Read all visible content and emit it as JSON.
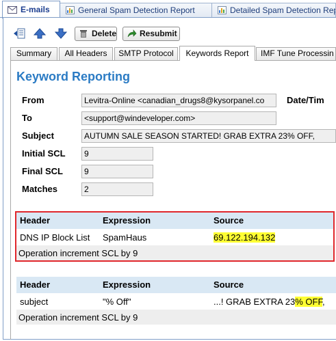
{
  "top_tabs": [
    {
      "label": "E-mails",
      "active": true
    },
    {
      "label": "General Spam Detection Report",
      "active": false
    },
    {
      "label": "Detailed Spam Detection Rep",
      "active": false
    }
  ],
  "toolbar": {
    "delete_label": "Delete",
    "resubmit_label": "Resubmit"
  },
  "sub_tabs": [
    {
      "label": "Summary"
    },
    {
      "label": "All Headers"
    },
    {
      "label": "SMTP Protocol"
    },
    {
      "label": "Keywords Report",
      "active": true
    },
    {
      "label": "IMF Tune Processin"
    }
  ],
  "page_title": "Keyword Reporting",
  "fields": {
    "from_label": "From",
    "from_value": "Levitra-Online <canadian_drugs8@kysorpanel.co",
    "datetime_label": "Date/Tim",
    "to_label": "To",
    "to_value": "<support@windeveloper.com>",
    "subject_label": "Subject",
    "subject_value": "AUTUMN SALE SEASON STARTED! GRAB EXTRA 23% OFF,",
    "initial_scl_label": "Initial SCL",
    "initial_scl_value": "9",
    "final_scl_label": "Final SCL",
    "final_scl_value": "9",
    "matches_label": "Matches",
    "matches_value": "2"
  },
  "table1": {
    "headers": [
      "Header",
      "Expression",
      "Source"
    ],
    "row": [
      "DNS IP Block List",
      "SpamHaus",
      "69.122.194.132"
    ],
    "operation": "Operation increment SCL by 9"
  },
  "table2": {
    "headers": [
      "Header",
      "Expression",
      "Source"
    ],
    "row": [
      "subject",
      "\"% Off\"",
      "...! GRAB EXTRA 23",
      "% OFF",
      ","
    ],
    "operation": "Operation increment SCL by 9"
  },
  "colors": {
    "accent_title": "#2b7bc4",
    "header_bg": "#d9e8f4",
    "highlight": "#ffff33",
    "red_box": "#e0262b"
  },
  "icons": [
    "mail-tab-icon",
    "report-tab-icon",
    "move-icon",
    "arrow-up-icon",
    "arrow-down-icon",
    "trash-icon",
    "resubmit-icon"
  ]
}
